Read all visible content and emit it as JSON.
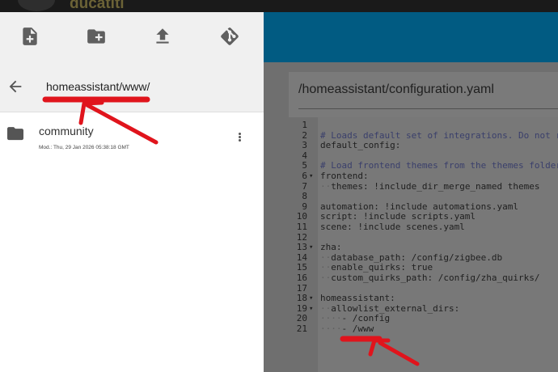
{
  "window": {
    "title": "ducatiti"
  },
  "file_browser": {
    "toolbar": {
      "new_file_icon": "note-add-icon",
      "new_folder_icon": "create-new-folder-icon",
      "upload_icon": "upload-icon",
      "git_icon": "git-icon"
    },
    "current_directory": "homeassistant/www/",
    "items": [
      {
        "type": "folder",
        "name": "community",
        "modified": "Mod.: Thu, 29 Jan 2026 05:38:18 GMT"
      }
    ]
  },
  "editor": {
    "file_path": "/homeassistant/configuration.yaml",
    "lines": [
      {
        "n": "1",
        "fold": "",
        "text": ""
      },
      {
        "n": "2",
        "fold": "",
        "text": "# Loads default set of integrations. Do not re"
      },
      {
        "n": "3",
        "fold": "",
        "text": "default_config:"
      },
      {
        "n": "4",
        "fold": "",
        "text": ""
      },
      {
        "n": "5",
        "fold": "",
        "text": "# Load frontend themes from the themes folder"
      },
      {
        "n": "6",
        "fold": "▾",
        "text": "frontend:"
      },
      {
        "n": "7",
        "fold": "",
        "text": "  themes: !include_dir_merge_named themes"
      },
      {
        "n": "8",
        "fold": "",
        "text": ""
      },
      {
        "n": "9",
        "fold": "",
        "text": "automation: !include automations.yaml"
      },
      {
        "n": "10",
        "fold": "",
        "text": "script: !include scripts.yaml"
      },
      {
        "n": "11",
        "fold": "",
        "text": "scene: !include scenes.yaml"
      },
      {
        "n": "12",
        "fold": "",
        "text": ""
      },
      {
        "n": "13",
        "fold": "▾",
        "text": "zha:"
      },
      {
        "n": "14",
        "fold": "",
        "text": "  database_path: /config/zigbee.db"
      },
      {
        "n": "15",
        "fold": "",
        "text": "  enable_quirks: true"
      },
      {
        "n": "16",
        "fold": "",
        "text": "  custom_quirks_path: /config/zha_quirks/"
      },
      {
        "n": "17",
        "fold": "",
        "text": ""
      },
      {
        "n": "18",
        "fold": "▾",
        "text": "homeassistant:"
      },
      {
        "n": "19",
        "fold": "▾",
        "text": "  allowlist_external_dirs:"
      },
      {
        "n": "20",
        "fold": "",
        "text": "    - /config"
      },
      {
        "n": "21",
        "fold": "",
        "text": "    - /www"
      }
    ]
  },
  "colors": {
    "header_blue": "#015b82",
    "annotation_red": "#e0141c",
    "panel_bg": "#ffffff"
  }
}
